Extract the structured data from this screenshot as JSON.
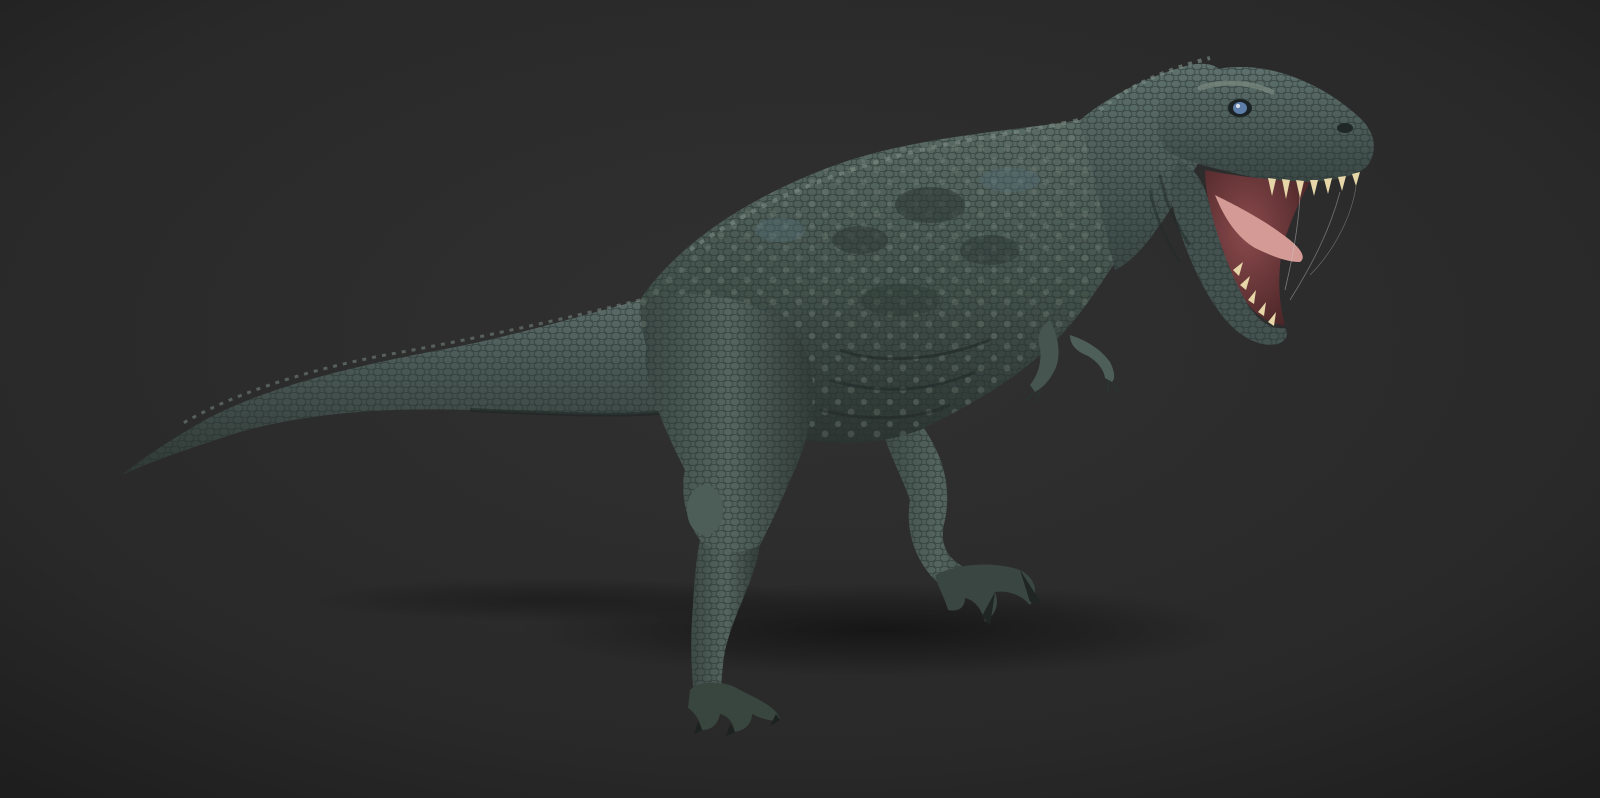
{
  "scene": {
    "subject": "tyrannosaurus-3d-sculpt",
    "colors": {
      "background_center": "#2f2f2f",
      "background_edge": "#1f1f1f",
      "skin_dark": "#2e3a37",
      "skin_mid": "#4a5a55",
      "skin_light": "#6d7c74",
      "skin_blue_tint": "#4f6670",
      "mouth_pink": "#c98f8c",
      "tongue": "#d9a09b",
      "teeth": "#e8dcb0",
      "eye_blue": "#5d7ea8",
      "shadow": "#151515"
    }
  }
}
